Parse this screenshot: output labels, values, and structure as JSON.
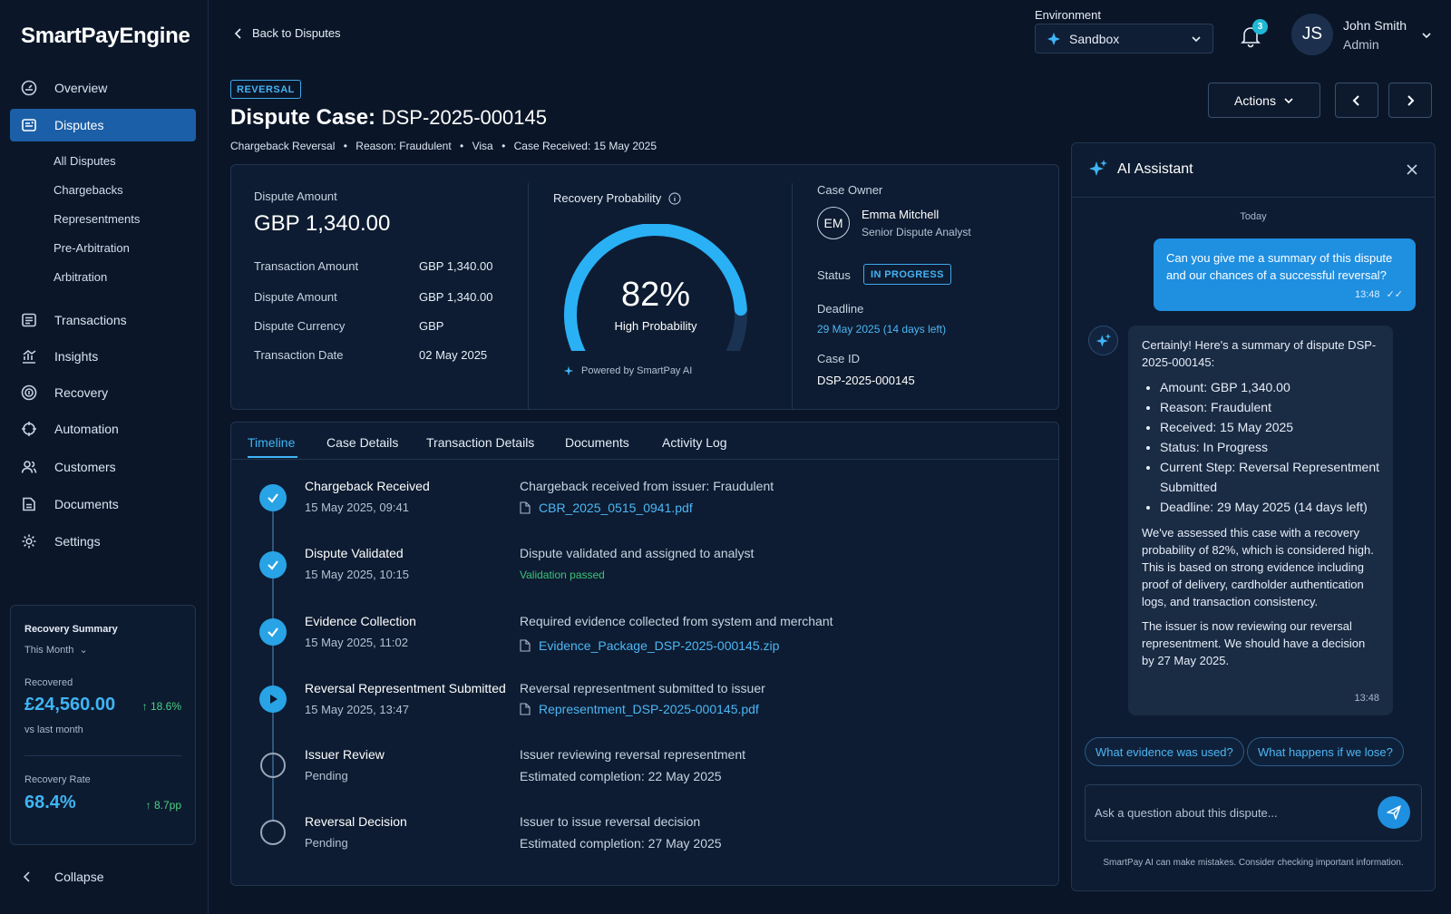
{
  "app": {
    "name": "SmartPayEngine"
  },
  "sidebar": {
    "items": [
      {
        "label": "Overview",
        "icon": "gauge-icon"
      },
      {
        "label": "Disputes",
        "icon": "disputes-icon",
        "active": true
      },
      {
        "label": "Transactions",
        "icon": "list-icon"
      },
      {
        "label": "Insights",
        "icon": "chart-icon"
      },
      {
        "label": "Recovery",
        "icon": "recovery-icon"
      },
      {
        "label": "Automation",
        "icon": "crosshair-icon"
      },
      {
        "label": "Customers",
        "icon": "users-icon"
      },
      {
        "label": "Documents",
        "icon": "document-icon"
      },
      {
        "label": "Settings",
        "icon": "gear-icon"
      }
    ],
    "subitems": [
      "All Disputes",
      "Chargebacks",
      "Representments",
      "Pre-Arbitration",
      "Arbitration"
    ],
    "recovery_summary": {
      "title": "Recovery Summary",
      "period": "This Month",
      "recovered_label": "Recovered",
      "recovered_value": "£24,560.00",
      "recovered_change": "18.6%",
      "vs_label": "vs last month",
      "rate_label": "Recovery Rate",
      "rate_value": "68.4%",
      "rate_change": "8.7pp"
    },
    "collapse_label": "Collapse"
  },
  "header": {
    "back_label": "Back to Disputes",
    "environment_label": "Environment",
    "environment_value": "Sandbox",
    "notification_count": "3",
    "user_initials": "JS",
    "user_name": "John Smith",
    "user_role": "Admin"
  },
  "case": {
    "badge": "REVERSAL",
    "title_prefix": "Dispute Case:",
    "id": "DSP-2025-000145",
    "meta": {
      "type": "Chargeback Reversal",
      "reason": "Reason: Fraudulent",
      "network": "Visa",
      "received": "Case Received: 15 May 2025"
    },
    "actions_label": "Actions"
  },
  "amounts": {
    "title": "Dispute Amount",
    "value": "GBP 1,340.00",
    "rows": [
      {
        "label": "Transaction Amount",
        "value": "GBP 1,340.00"
      },
      {
        "label": "Dispute Amount",
        "value": "GBP 1,340.00"
      },
      {
        "label": "Dispute Currency",
        "value": "GBP"
      },
      {
        "label": "Transaction Date",
        "value": "02 May 2025"
      }
    ]
  },
  "probability": {
    "title": "Recovery Probability",
    "percent": 82,
    "percent_label": "82%",
    "label": "High Probability",
    "powered": "Powered by SmartPay AI",
    "color": "#29b0f5"
  },
  "owner": {
    "label": "Case Owner",
    "initials": "EM",
    "name": "Emma Mitchell",
    "role": "Senior Dispute Analyst",
    "status_label": "Status",
    "status": "IN PROGRESS",
    "deadline_label": "Deadline",
    "deadline": "29 May 2025 (14 days left)",
    "case_id_label": "Case ID",
    "case_id": "DSP-2025-000145"
  },
  "tabs": [
    "Timeline",
    "Case Details",
    "Transaction Details",
    "Documents",
    "Activity Log"
  ],
  "timeline": [
    {
      "title": "Chargeback Received",
      "date": "15 May 2025, 09:41",
      "state": "done",
      "desc": "Chargeback received from issuer: Fraudulent",
      "file": "CBR_2025_0515_0941.pdf"
    },
    {
      "title": "Dispute Validated",
      "date": "15 May 2025, 10:15",
      "state": "done",
      "desc": "Dispute validated and assigned to analyst",
      "note": "Validation passed"
    },
    {
      "title": "Evidence Collection",
      "date": "15 May 2025, 11:02",
      "state": "done",
      "desc": "Required evidence collected from system and merchant",
      "file": "Evidence_Package_DSP-2025-000145.zip"
    },
    {
      "title": "Reversal Representment Submitted",
      "date": "15 May 2025, 13:47",
      "state": "active",
      "desc": "Reversal representment submitted to issuer",
      "file": "Representment_DSP-2025-000145.pdf"
    },
    {
      "title": "Issuer Review",
      "date": "Pending",
      "state": "pending",
      "desc": "Issuer reviewing reversal representment",
      "est": "Estimated completion:  22 May 2025"
    },
    {
      "title": "Reversal Decision",
      "date": "Pending",
      "state": "pending",
      "desc": "Issuer to issue reversal decision",
      "est": "Estimated completion:  27 May 2025"
    }
  ],
  "ai": {
    "title": "AI Assistant",
    "today": "Today",
    "user_message": "Can you give me a summary of this dispute and our chances of a successful reversal?",
    "user_time": "13:48",
    "reply_intro": "Certainly! Here's a summary of dispute DSP-2025-000145:",
    "reply_bullets": [
      "Amount: GBP 1,340.00",
      "Reason: Fraudulent",
      "Received: 15 May 2025",
      "Status: In Progress",
      "Current Step: Reversal Representment Submitted",
      "Deadline: 29 May 2025 (14 days left)"
    ],
    "reply_p1": "We've assessed this case with a recovery probability of 82%, which is considered high. This is based on strong evidence including proof of delivery, cardholder authentication logs, and transaction consistency.",
    "reply_p2": "The issuer is now reviewing our reversal representment. We should have a decision by 27 May 2025.",
    "reply_time": "13:48",
    "suggestions": [
      "What evidence was used?",
      "What happens if we lose?"
    ],
    "input_placeholder": "Ask a question about this dispute...",
    "disclaimer": "SmartPay AI can make mistakes. Consider checking important information."
  }
}
